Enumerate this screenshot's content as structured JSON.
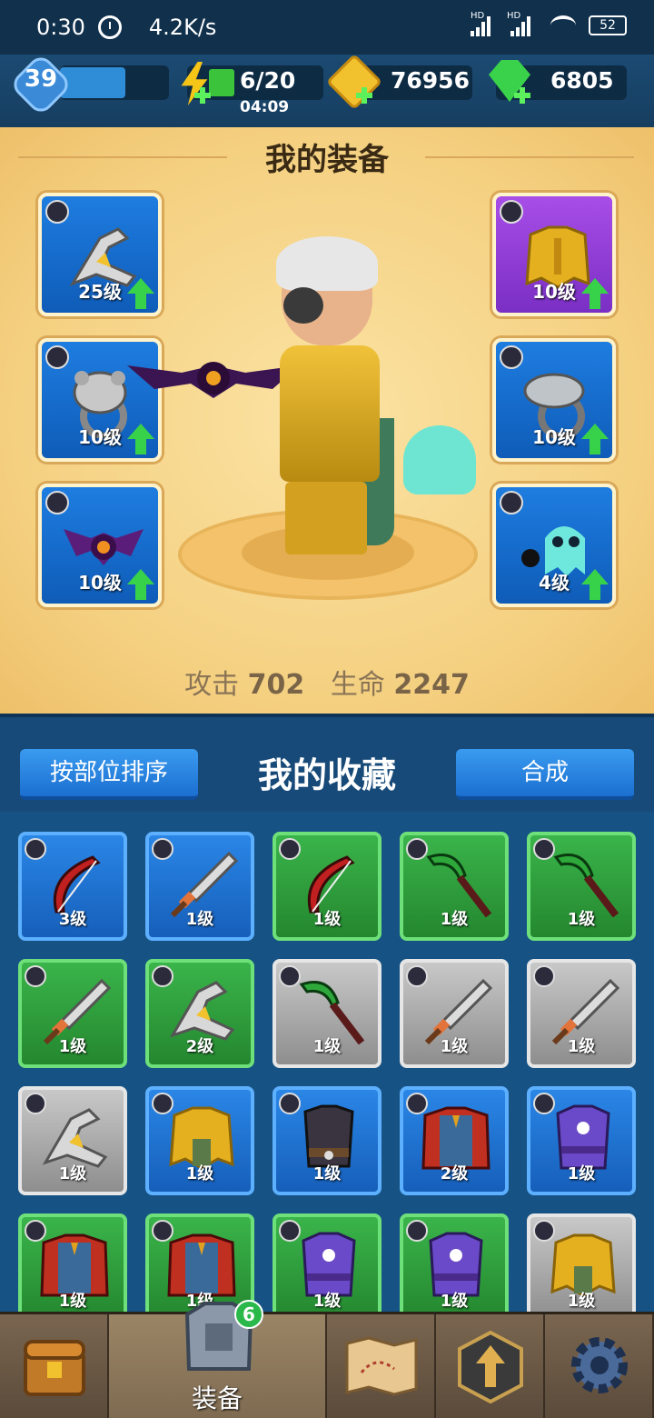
{
  "status_bar": {
    "time": "0:30",
    "speed": "4.2K/s",
    "battery": "52",
    "signal_1": "HD",
    "signal_2": "HD"
  },
  "resources": {
    "level": "39",
    "xp_fraction": 0.62,
    "energy": "6/20",
    "energy_timer": "04:09",
    "coins": "76956",
    "gems": "6805"
  },
  "equipment": {
    "title": "我的装备",
    "slots": [
      {
        "name": "weapon",
        "type_icon": "weapon-type-icon",
        "item_icon": "boomerang-icon",
        "level": "25级",
        "color": "blue",
        "upgrade": true
      },
      {
        "name": "armor",
        "type_icon": "armor-type-icon",
        "item_icon": "gold-armor-icon",
        "level": "10级",
        "color": "purple",
        "upgrade": true
      },
      {
        "name": "ring-left",
        "type_icon": "ring-type-icon",
        "item_icon": "bear-ring-icon",
        "level": "10级",
        "color": "blue",
        "upgrade": true
      },
      {
        "name": "ring-right",
        "type_icon": "ring-type-icon",
        "item_icon": "snake-ring-icon",
        "level": "10级",
        "color": "blue",
        "upgrade": true
      },
      {
        "name": "pet-left",
        "type_icon": "pet-type-icon",
        "item_icon": "bat-pet-icon",
        "level": "10级",
        "color": "blue",
        "upgrade": true
      },
      {
        "name": "pet-right",
        "type_icon": "pet-type-icon",
        "item_icon": "ghost-pet-icon",
        "level": "4级",
        "color": "blue",
        "upgrade": true
      }
    ],
    "stats": {
      "attack_label": "攻击",
      "attack_value": "702",
      "hp_label": "生命",
      "hp_value": "2247"
    }
  },
  "collection": {
    "sort_button": "按部位排序",
    "title": "我的收藏",
    "merge_button": "合成",
    "items": [
      {
        "icon": "bow-icon",
        "level": "3级",
        "rarity": "blue",
        "type": "weapon"
      },
      {
        "icon": "sword-icon",
        "level": "1级",
        "rarity": "blue",
        "type": "weapon"
      },
      {
        "icon": "bow-icon",
        "level": "1级",
        "rarity": "green",
        "type": "weapon"
      },
      {
        "icon": "scythe-icon",
        "level": "1级",
        "rarity": "green",
        "type": "weapon"
      },
      {
        "icon": "scythe-icon",
        "level": "1级",
        "rarity": "green",
        "type": "weapon"
      },
      {
        "icon": "sword-icon",
        "level": "1级",
        "rarity": "green",
        "type": "weapon"
      },
      {
        "icon": "boomerang-icon",
        "level": "2级",
        "rarity": "green",
        "type": "weapon"
      },
      {
        "icon": "scythe-icon",
        "level": "1级",
        "rarity": "gray",
        "type": "weapon"
      },
      {
        "icon": "sword-icon",
        "level": "1级",
        "rarity": "gray",
        "type": "weapon"
      },
      {
        "icon": "sword-icon",
        "level": "1级",
        "rarity": "gray",
        "type": "weapon"
      },
      {
        "icon": "boomerang-icon",
        "level": "1级",
        "rarity": "gray",
        "type": "weapon"
      },
      {
        "icon": "gold-armor-icon",
        "level": "1级",
        "rarity": "blue",
        "type": "armor"
      },
      {
        "icon": "dark-vest-icon",
        "level": "1级",
        "rarity": "blue",
        "type": "armor"
      },
      {
        "icon": "red-cape-armor-icon",
        "level": "2级",
        "rarity": "blue",
        "type": "armor"
      },
      {
        "icon": "purple-robe-icon",
        "level": "1级",
        "rarity": "blue",
        "type": "armor"
      },
      {
        "icon": "red-cape-armor-icon",
        "level": "1级",
        "rarity": "green",
        "type": "armor"
      },
      {
        "icon": "red-cape-armor-icon",
        "level": "1级",
        "rarity": "green",
        "type": "armor"
      },
      {
        "icon": "purple-robe-icon",
        "level": "1级",
        "rarity": "green",
        "type": "armor"
      },
      {
        "icon": "purple-robe-icon",
        "level": "1级",
        "rarity": "green",
        "type": "armor"
      },
      {
        "icon": "gold-armor-icon",
        "level": "1级",
        "rarity": "gray",
        "type": "armor"
      }
    ]
  },
  "nav": {
    "tabs": [
      {
        "name": "shop",
        "icon": "treasure-chest-icon",
        "label": ""
      },
      {
        "name": "equipment",
        "icon": "armor-icon",
        "label": "装备",
        "badge": "6"
      },
      {
        "name": "map",
        "icon": "map-icon",
        "label": ""
      },
      {
        "name": "talent",
        "icon": "upgrade-arrow-icon",
        "label": ""
      },
      {
        "name": "settings",
        "icon": "gear-icon",
        "label": ""
      }
    ]
  },
  "colors": {
    "blue_rarity": "#2a86e6",
    "green_rarity": "#3ab44a",
    "gray_rarity": "#a8a8a8",
    "purple_rarity": "#a84de8",
    "panel_bg": "#f4cf7f"
  }
}
